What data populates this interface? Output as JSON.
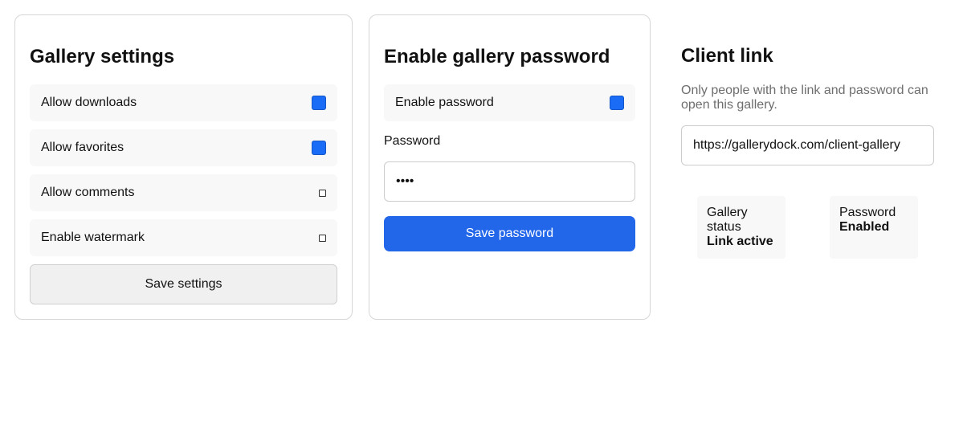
{
  "gallery_settings": {
    "title": "Gallery settings",
    "toggles": [
      {
        "label": "Allow downloads",
        "checked": true
      },
      {
        "label": "Allow favorites",
        "checked": true
      },
      {
        "label": "Allow comments",
        "checked": false
      },
      {
        "label": "Enable watermark",
        "checked": false
      }
    ],
    "save_label": "Save settings"
  },
  "password_settings": {
    "title": "Enable gallery password",
    "toggle": {
      "label": "Enable password",
      "checked": true
    },
    "field_label": "Password",
    "field_value": "••••",
    "save_label": "Save password"
  },
  "client_link": {
    "title": "Client link",
    "description": "Only people with the link and password can open this gallery.",
    "url": "https://gallerydock.com/client-gallery",
    "stats": [
      {
        "label": "Gallery status",
        "value": "Link active"
      },
      {
        "label": "Password",
        "value": "Enabled"
      }
    ]
  },
  "colors": {
    "accent": "#2266ea",
    "checkbox_checked": "#1a6bf5",
    "row_background": "#f8f8f8",
    "border": "#d6d6d6",
    "muted_text": "#6e6e6e"
  }
}
